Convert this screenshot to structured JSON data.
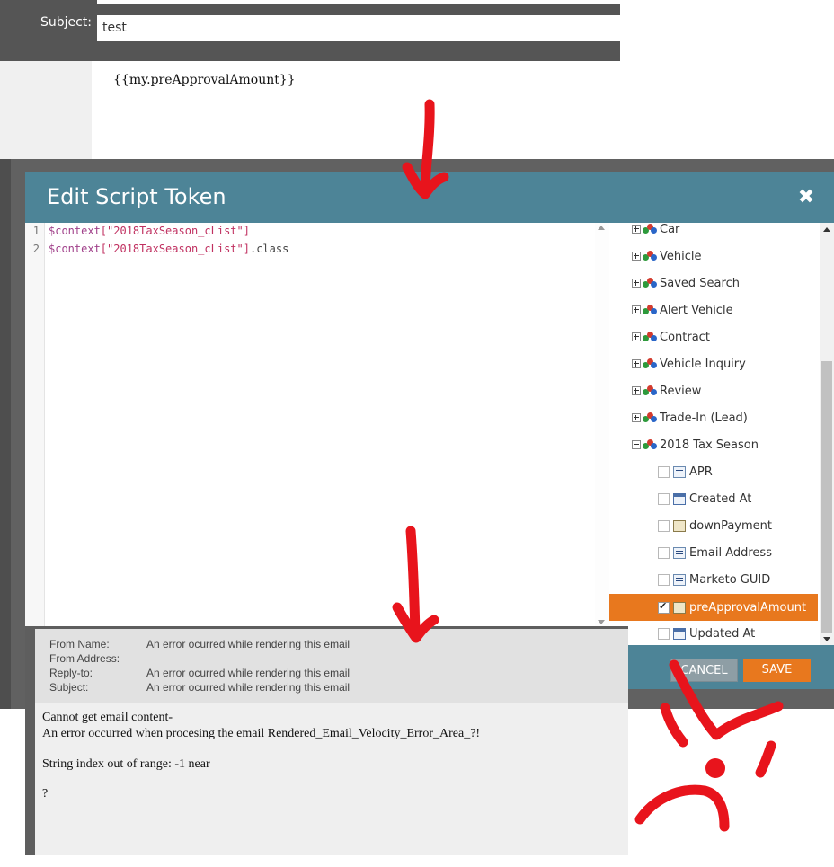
{
  "email_editor": {
    "subject_label": "Subject:",
    "subject_value": "test",
    "body_token": "{{my.preApprovalAmount}}"
  },
  "dialog": {
    "title": "Edit Script Token",
    "close_icon": "close-icon",
    "code_lines": [
      {
        "num": "1",
        "var": "$context",
        "str": "[\"2018TaxSeason_cList\"]",
        "rest": ""
      },
      {
        "num": "2",
        "var": "$context",
        "str": "[\"2018TaxSeason_cList\"]",
        "rest": ".class"
      }
    ],
    "tree": {
      "objects": [
        "Car",
        "Vehicle",
        "Saved Search",
        "Alert Vehicle",
        "Contract",
        "Vehicle Inquiry",
        "Review",
        "Trade-In (Lead)",
        "2018 Tax Season"
      ],
      "fields": [
        {
          "label": "APR",
          "type": "text",
          "checked": false
        },
        {
          "label": "Created At",
          "type": "date",
          "checked": false
        },
        {
          "label": "downPayment",
          "type": "number",
          "checked": false
        },
        {
          "label": "Email Address",
          "type": "text",
          "checked": false
        },
        {
          "label": "Marketo GUID",
          "type": "text",
          "checked": false
        },
        {
          "label": "preApprovalAmount",
          "type": "number",
          "checked": true
        },
        {
          "label": "Updated At",
          "type": "date",
          "checked": false
        }
      ]
    },
    "buttons": {
      "cancel": "CANCEL",
      "save": "SAVE"
    }
  },
  "preview": {
    "from_name_label": "From Name:",
    "from_name_value": "An error ocurred while rendering this email",
    "from_address_label": "From Address:",
    "reply_to_label": "Reply-to:",
    "reply_to_value": "An error ocurred while rendering this email",
    "subject_label": "Subject:",
    "subject_value": "An error ocurred while rendering this email",
    "body_lines": [
      "Cannot get email content-",
      "An error occurred when procesing the email Rendered_Email_Velocity_Error_Area_?!",
      "String index out of range: -1 near",
      "?"
    ]
  },
  "colors": {
    "dialog_header": "#4d8497",
    "accent_orange": "#e8781e",
    "annotation_red": "#e8141c"
  }
}
